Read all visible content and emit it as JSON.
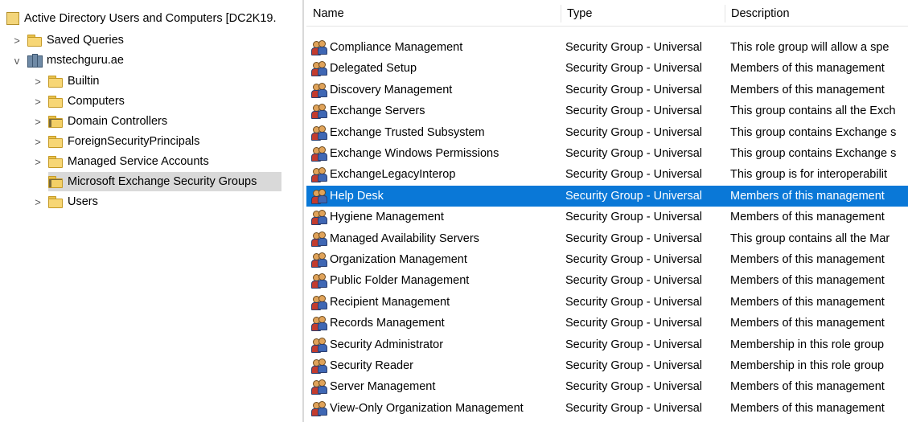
{
  "tree": {
    "root": {
      "label": "Active Directory Users and Computers [DC2K19."
    },
    "saved_queries": {
      "label": "Saved Queries",
      "expander": ">"
    },
    "domain": {
      "label": "mstechguru.ae",
      "expander": "v"
    },
    "children": [
      {
        "label": "Builtin",
        "expander": ">"
      },
      {
        "label": "Computers",
        "expander": ">"
      },
      {
        "label": "Domain Controllers",
        "expander": ">"
      },
      {
        "label": "ForeignSecurityPrincipals",
        "expander": ">"
      },
      {
        "label": "Managed Service Accounts",
        "expander": ">"
      },
      {
        "label": "Microsoft Exchange Security Groups",
        "expander": ""
      },
      {
        "label": "Users",
        "expander": ">"
      }
    ]
  },
  "list": {
    "columns": {
      "name": "Name",
      "type": "Type",
      "description": "Description"
    },
    "rows": [
      {
        "name": "Compliance Management",
        "type": "Security Group - Universal",
        "description": "This role group will allow a spe"
      },
      {
        "name": "Delegated Setup",
        "type": "Security Group - Universal",
        "description": "Members of this management"
      },
      {
        "name": "Discovery Management",
        "type": "Security Group - Universal",
        "description": "Members of this management"
      },
      {
        "name": "Exchange Servers",
        "type": "Security Group - Universal",
        "description": "This group contains all the Exch"
      },
      {
        "name": "Exchange Trusted Subsystem",
        "type": "Security Group - Universal",
        "description": "This group contains Exchange s"
      },
      {
        "name": "Exchange Windows Permissions",
        "type": "Security Group - Universal",
        "description": "This group contains Exchange s"
      },
      {
        "name": "ExchangeLegacyInterop",
        "type": "Security Group - Universal",
        "description": "This group is for interoperabilit"
      },
      {
        "name": "Help Desk",
        "type": "Security Group - Universal",
        "description": "Members of this management"
      },
      {
        "name": "Hygiene Management",
        "type": "Security Group - Universal",
        "description": "Members of this management"
      },
      {
        "name": "Managed Availability Servers",
        "type": "Security Group - Universal",
        "description": "This group contains all the Mar"
      },
      {
        "name": "Organization Management",
        "type": "Security Group - Universal",
        "description": "Members of this management"
      },
      {
        "name": "Public Folder Management",
        "type": "Security Group - Universal",
        "description": "Members of this management"
      },
      {
        "name": "Recipient Management",
        "type": "Security Group - Universal",
        "description": "Members of this management"
      },
      {
        "name": "Records Management",
        "type": "Security Group - Universal",
        "description": "Members of this management"
      },
      {
        "name": "Security Administrator",
        "type": "Security Group - Universal",
        "description": "Membership in this role group"
      },
      {
        "name": "Security Reader",
        "type": "Security Group - Universal",
        "description": "Membership in this role group"
      },
      {
        "name": "Server Management",
        "type": "Security Group - Universal",
        "description": "Members of this management"
      },
      {
        "name": "View-Only Organization Management",
        "type": "Security Group - Universal",
        "description": "Members of this management"
      }
    ]
  },
  "colors": {
    "selection": "#0a78d7",
    "tree_selection": "#d9d9d9",
    "folder": "#f7d675"
  },
  "icons": {
    "group": "security-group-icon",
    "folder": "folder-icon",
    "domain": "domain-icon",
    "root": "ad-root-icon"
  }
}
